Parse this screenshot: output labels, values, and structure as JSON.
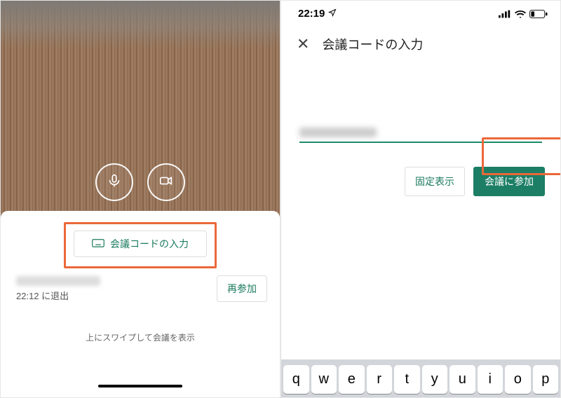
{
  "left": {
    "enter_code_label": "会議コードの入力",
    "history": {
      "left_at_text": "22:12 に退出",
      "rejoin_label": "再参加"
    },
    "swipe_hint": "上にスワイプして会議を表示"
  },
  "right": {
    "status": {
      "time": "22:19"
    },
    "title": "会議コードの入力",
    "pin_label": "固定表示",
    "join_label": "会議に参加",
    "keyboard_row": [
      "q",
      "w",
      "e",
      "r",
      "t",
      "y",
      "u",
      "i",
      "o",
      "p"
    ]
  },
  "colors": {
    "accent_green": "#1b7e65",
    "highlight_orange": "#ec683a"
  }
}
